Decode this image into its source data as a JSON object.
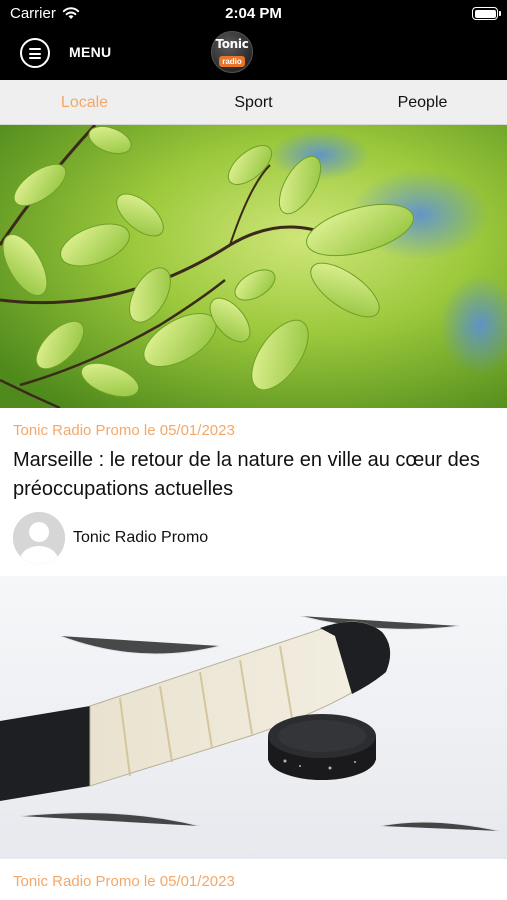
{
  "status_bar": {
    "carrier": "Carrier",
    "time": "2:04 PM"
  },
  "header": {
    "menu_label": "MENU",
    "logo_top": "Tonic",
    "logo_bottom": "radio"
  },
  "tabs": [
    {
      "label": "Locale",
      "active": true
    },
    {
      "label": "Sport",
      "active": false
    },
    {
      "label": "People",
      "active": false
    }
  ],
  "colors": {
    "accent": "#f3a86a",
    "header_bg": "#000000",
    "tab_bg": "#efefef"
  },
  "articles": [
    {
      "meta": "Tonic Radio Promo le 05/01/2023",
      "title": "Marseille : le retour de la nature en ville au cœur des préoccupations actuelles",
      "author": "Tonic Radio Promo",
      "image": "green-leaves-photo"
    },
    {
      "meta": "Tonic Radio Promo le 05/01/2023",
      "image": "hockey-stick-puck-photo"
    }
  ]
}
